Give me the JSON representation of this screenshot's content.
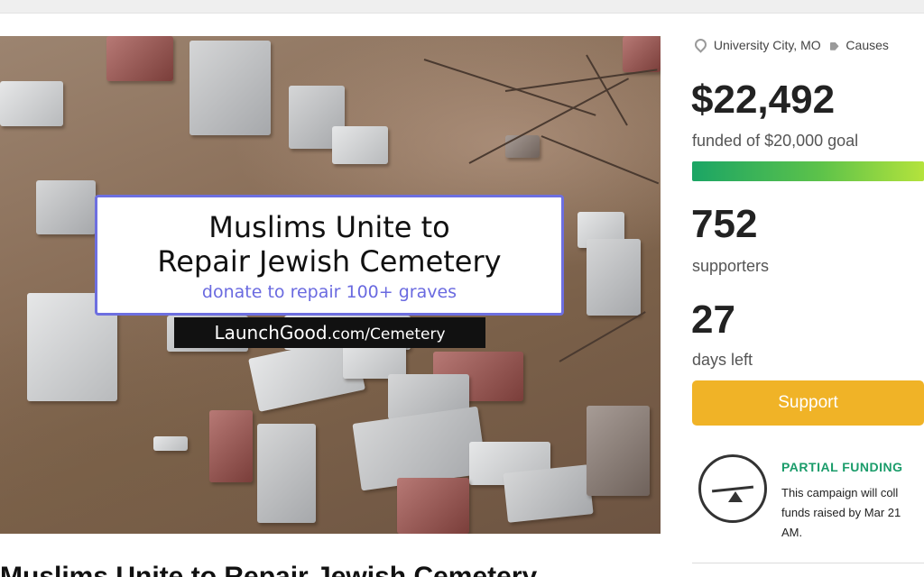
{
  "hero": {
    "banner_title": "Muslims Unite to\nRepair Jewish Cemetery",
    "banner_subtitle": "donate to repair 100+ graves",
    "url_brand": "LaunchGood",
    "url_path": ".com/Cemetery"
  },
  "meta": {
    "location": "University City, MO",
    "category": "Causes",
    "location_icon": "map-pin-icon",
    "category_icon": "tag-icon"
  },
  "stats": {
    "amount": "$22,492",
    "goal_text": "funded of $20,000 goal",
    "progress_fraction": 1.0,
    "supporters_count": "752",
    "supporters_label": "supporters",
    "days_count": "27",
    "days_label": "days left"
  },
  "support_button": "Support",
  "partial_funding": {
    "icon": "seesaw-icon",
    "title": "PARTIAL FUNDING",
    "text": "This campaign will coll funds raised by Mar 21 AM."
  },
  "page_title": "Muslims Unite to Repair Jewish Cemetery",
  "colors": {
    "accent_green": "#1a9c6a",
    "support_orange": "#f0b327",
    "banner_border": "#6d6fe0"
  }
}
